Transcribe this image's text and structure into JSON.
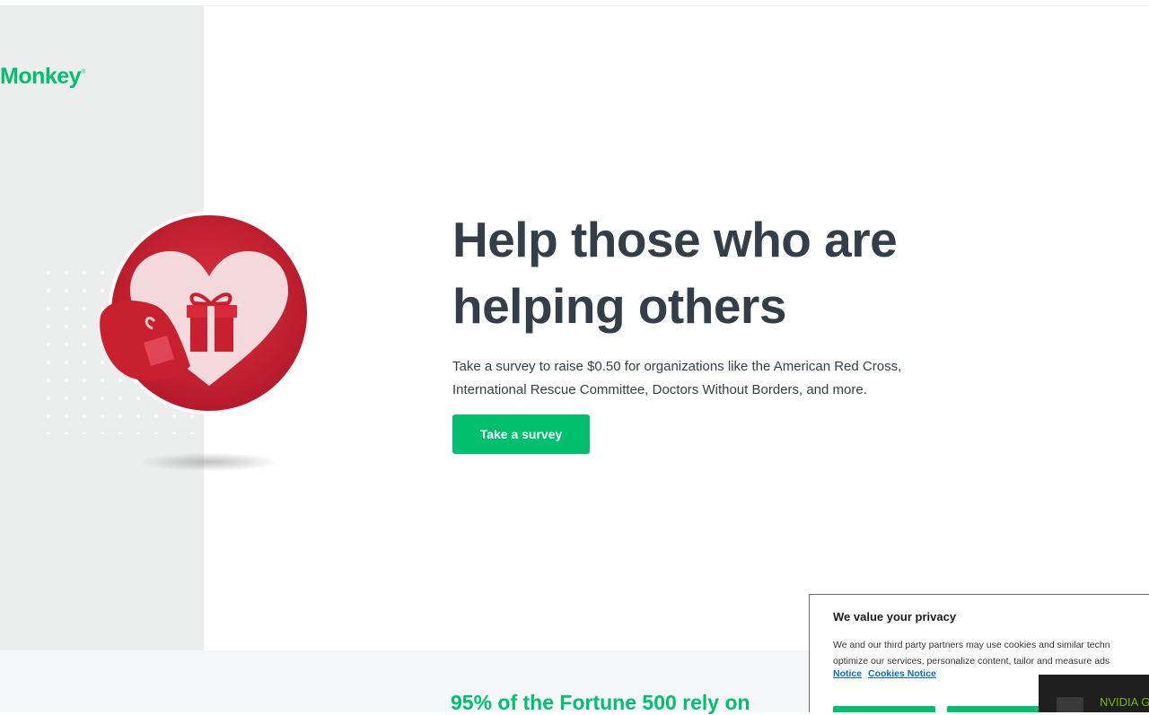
{
  "brand": {
    "logo_text": "Monkey",
    "logo_mark": "®"
  },
  "hero": {
    "title": "Help those who are helping others",
    "description": "Take a survey to raise $0.50 for organizations like the American Red Cross, International Rescue Committee, Doctors Without Borders, and more.",
    "cta_label": "Take a survey"
  },
  "band": {
    "title": "95% of the Fortune 500 rely on"
  },
  "cookie_banner": {
    "title": "We value your privacy",
    "text_line1": "We and our third party partners may use cookies and similar techn",
    "text_line2": "optimize our services, personalize content, tailor and measure ads",
    "link_notice": "Notice",
    "link_cookies_notice": "Cookies Notice"
  },
  "overlay": {
    "text": "NVIDIA G"
  },
  "colors": {
    "accent": "#00bf6f",
    "heading": "#333e48",
    "panel": "#eceeed",
    "heart_red": "#d1243a"
  },
  "icons": {
    "illustration": "gift-heart-icon",
    "overlay_logo": "nvidia-icon"
  }
}
